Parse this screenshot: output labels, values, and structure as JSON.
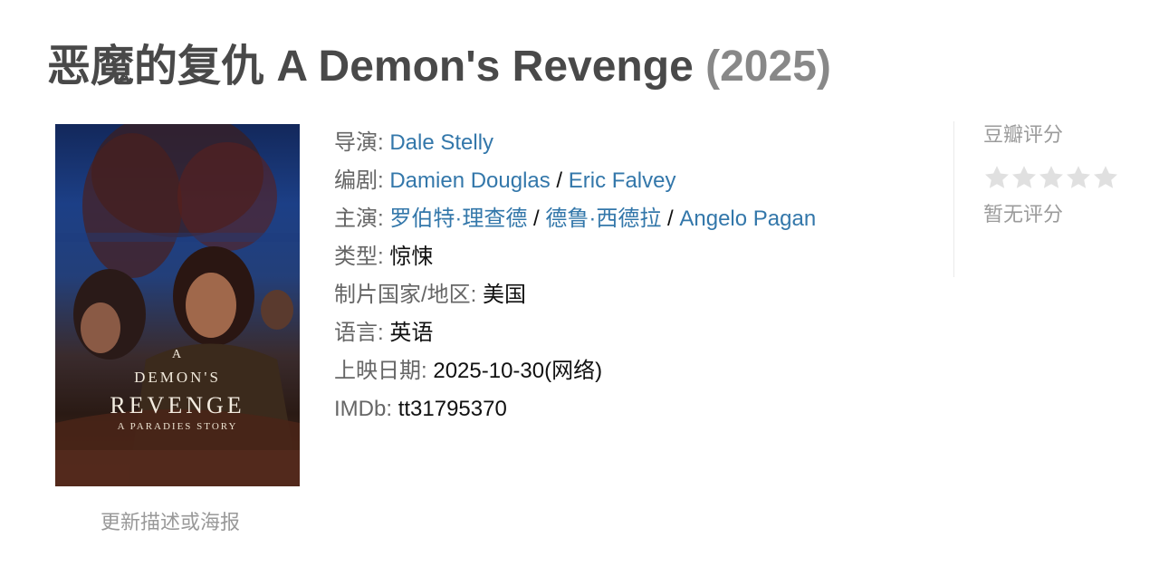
{
  "title": {
    "text": "恶魔的复仇 A Demon's Revenge",
    "year": "(2025)"
  },
  "poster": {
    "line1": "A",
    "line2": "DEMON'S",
    "line3": "REVENGE",
    "line4": "A PARADIES STORY"
  },
  "update_link": "更新描述或海报",
  "info": {
    "director": {
      "label": "导演",
      "names": [
        "Dale Stelly"
      ]
    },
    "writers": {
      "label": "编剧",
      "names": [
        "Damien Douglas",
        "Eric Falvey"
      ]
    },
    "cast": {
      "label": "主演",
      "names": [
        "罗伯特·理查德",
        "德鲁·西德拉",
        "Angelo Pagan"
      ]
    },
    "genre": {
      "label": "类型",
      "value": "惊悚"
    },
    "country": {
      "label": "制片国家/地区",
      "value": "美国"
    },
    "language": {
      "label": "语言",
      "value": "英语"
    },
    "release": {
      "label": "上映日期",
      "value": "2025-10-30(网络)"
    },
    "imdb": {
      "label": "IMDb",
      "value": "tt31795370"
    },
    "separator": " / ",
    "colon": ": "
  },
  "rating": {
    "label": "豆瓣评分",
    "stars_filled": 0,
    "stars_total": 5,
    "status": "暂无评分"
  },
  "colors": {
    "title": "#494949",
    "year": "#888888",
    "link": "#3377aa",
    "label": "#666666",
    "muted": "#999999",
    "star_empty": "#e0e0e0"
  }
}
